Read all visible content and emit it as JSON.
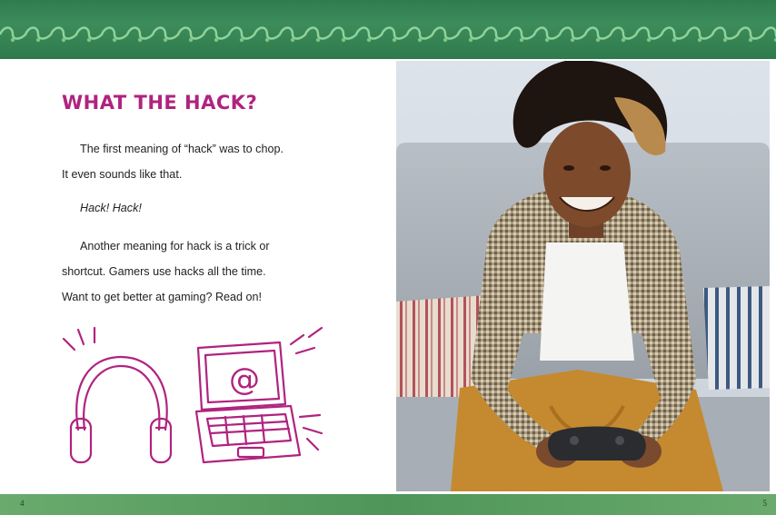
{
  "left_page": {
    "heading": "WHAT THE HACK?",
    "paragraph_1_line_1": "The first meaning of “hack” was to chop.",
    "paragraph_1_line_2": "It even sounds like that.",
    "paragraph_2": "Hack! Hack!",
    "paragraph_3_line_1": "Another meaning for hack is a trick or",
    "paragraph_3_line_2": "shortcut. Gamers use hacks all the time.",
    "paragraph_3_line_3": "Want to get better at gaming? Read on!",
    "laptop_screen_symbol": "@"
  },
  "page_numbers": {
    "left": "4",
    "right": "5"
  },
  "colors": {
    "heading": "#b0237f",
    "doodle": "#b0237f",
    "top_band": "#2f7d4f",
    "bottom_band": "#5a9d61"
  },
  "icons": [
    "headphones-icon",
    "laptop-icon"
  ]
}
